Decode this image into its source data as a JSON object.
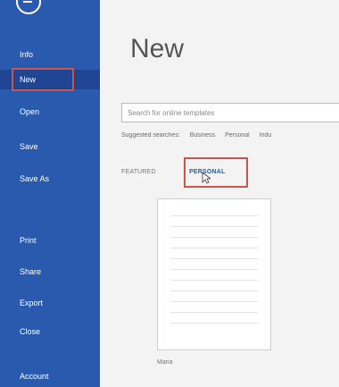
{
  "sidebar": {
    "items": [
      {
        "label": "Info",
        "state": "normal"
      },
      {
        "label": "New",
        "state": "selected"
      },
      {
        "label": "Open",
        "state": "normal"
      },
      {
        "label": "Save",
        "state": "normal"
      },
      {
        "label": "Save As",
        "state": "normal"
      },
      {
        "label": "",
        "state": "disabled"
      },
      {
        "label": "Print",
        "state": "normal"
      },
      {
        "label": "Share",
        "state": "normal"
      },
      {
        "label": "Export",
        "state": "normal"
      },
      {
        "label": "Close",
        "state": "normal"
      },
      {
        "label": "Account",
        "state": "normal"
      }
    ]
  },
  "main": {
    "title": "New",
    "search": {
      "placeholder": "Search for online templates"
    },
    "suggested": [
      "Suggested searches:",
      "Business",
      "Personal",
      "Indu"
    ],
    "tabs": {
      "featured": "FEATURED",
      "personal": "PERSONAL"
    },
    "template": {
      "name": "Maria"
    }
  },
  "colors": {
    "sidebar": "#2a5aae",
    "highlight": "#c9574d",
    "accent": "#2a5aae"
  }
}
